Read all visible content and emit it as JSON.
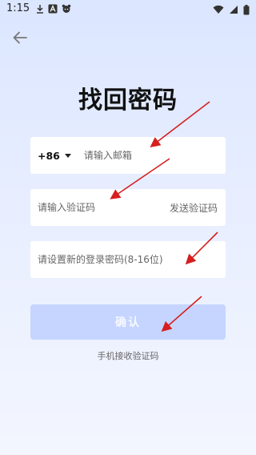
{
  "status_bar": {
    "time": "1:15",
    "left_icons": [
      "download-icon",
      "text-a-icon",
      "android-bug-icon"
    ],
    "right_icons": [
      "wifi-icon",
      "signal-icon",
      "battery-icon"
    ]
  },
  "header": {
    "back_icon": "arrow-left-icon"
  },
  "page": {
    "title": "找回密码"
  },
  "email_field": {
    "country_code": "+86",
    "placeholder": "请输入邮箱"
  },
  "code_field": {
    "placeholder": "请输入验证码",
    "send_label": "发送验证码"
  },
  "password_field": {
    "placeholder": "请设置新的登录密码(8-16位)"
  },
  "confirm_button": {
    "label": "确认"
  },
  "alt_link": {
    "label": "手机接收验证码"
  },
  "colors": {
    "background_top": "#dbe6ff",
    "button_disabled": "#c5d5ff",
    "annotation_arrow": "#d61f1f"
  }
}
